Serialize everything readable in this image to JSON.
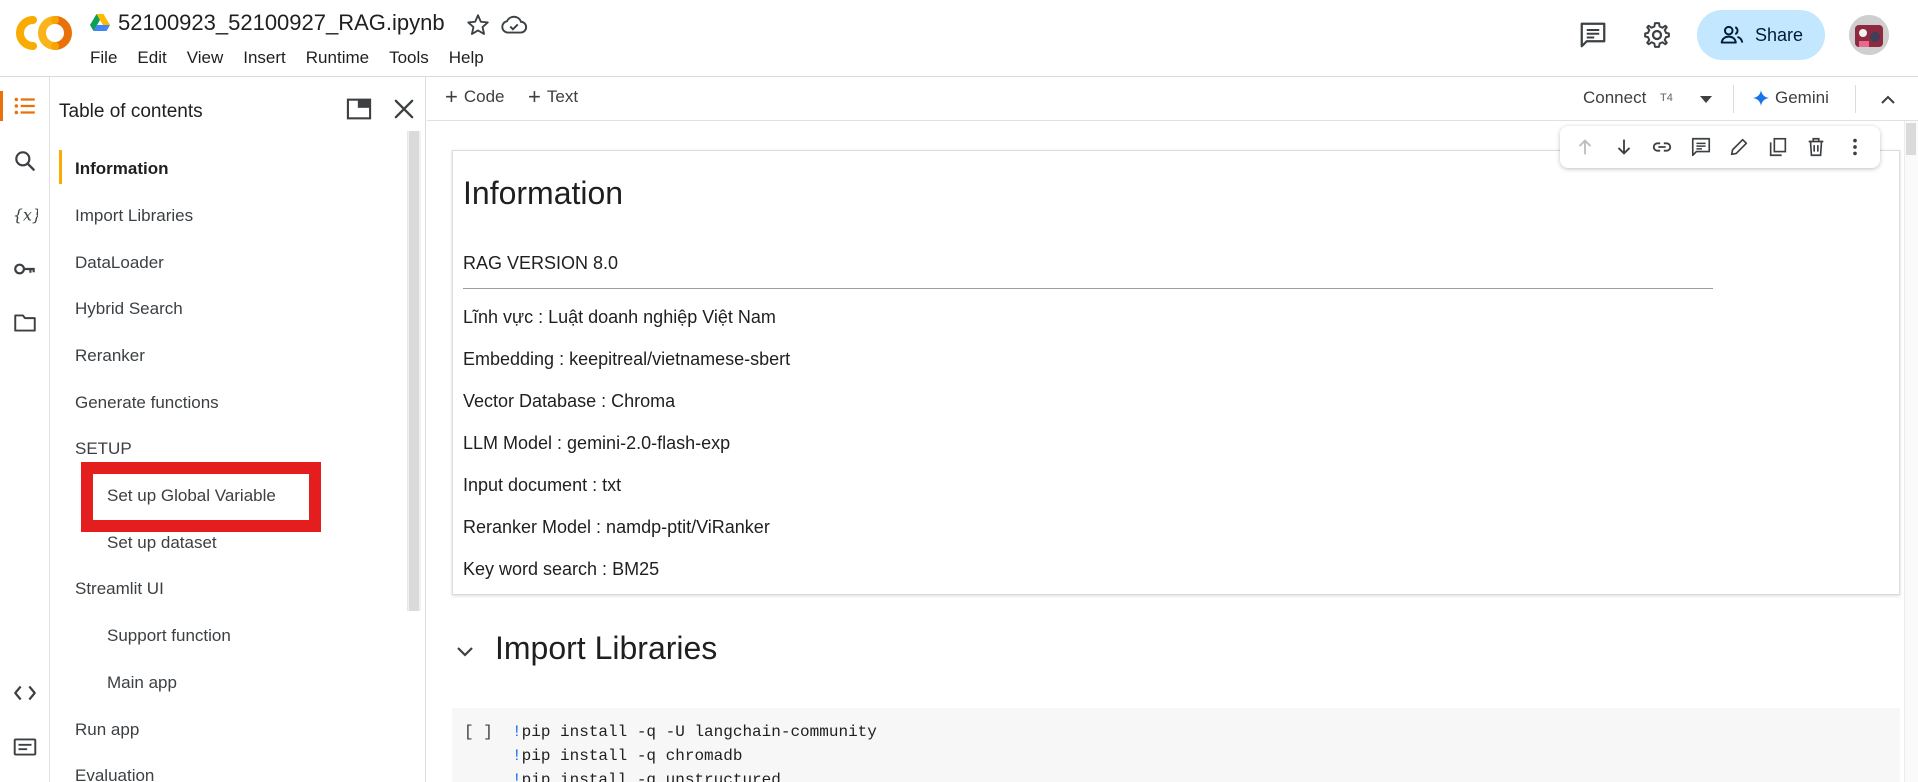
{
  "header": {
    "app_logo_text": "CO",
    "filename": "52100923_52100927_RAG.ipynb",
    "menu": [
      "File",
      "Edit",
      "View",
      "Insert",
      "Runtime",
      "Tools",
      "Help"
    ],
    "share_label": "Share"
  },
  "rail": {
    "items": [
      "table-of-contents",
      "search",
      "variables",
      "secrets",
      "files",
      "code-snippets",
      "terminal"
    ],
    "active": "table-of-contents"
  },
  "toc": {
    "title": "Table of contents",
    "items": [
      {
        "label": "Information",
        "level": 1,
        "active": true
      },
      {
        "label": "Import Libraries",
        "level": 1
      },
      {
        "label": "DataLoader",
        "level": 1
      },
      {
        "label": "Hybrid Search",
        "level": 1
      },
      {
        "label": "Reranker",
        "level": 1
      },
      {
        "label": "Generate functions",
        "level": 1
      },
      {
        "label": "SETUP",
        "level": 1
      },
      {
        "label": "Set up Global Variable",
        "level": 2,
        "highlighted": true
      },
      {
        "label": "Set up dataset",
        "level": 2
      },
      {
        "label": "Streamlit UI",
        "level": 1
      },
      {
        "label": "Support function",
        "level": 2
      },
      {
        "label": "Main app",
        "level": 2
      },
      {
        "label": "Run app",
        "level": 1
      },
      {
        "label": "Evaluation",
        "level": 1
      }
    ]
  },
  "notebook_toolbar": {
    "add_code_label": "Code",
    "add_text_label": "Text",
    "connect_label": "Connect",
    "runtime_type": "T4",
    "gemini_label": "Gemini"
  },
  "cell_toolbar": {
    "actions": [
      "move-up",
      "move-down",
      "link",
      "comment",
      "edit",
      "mirror-cell",
      "delete",
      "more"
    ]
  },
  "info_cell": {
    "heading": "Information",
    "version": "RAG VERSION 8.0",
    "lines": [
      "Lĩnh vực : Luật doanh nghiệp Việt Nam",
      "Embedding : keepitreal/vietnamese-sbert",
      "Vector Database : Chroma",
      "LLM Model : gemini-2.0-flash-exp",
      "Input document : txt",
      "Reranker Model : namdp-ptit/ViRanker",
      "Key word search : BM25"
    ]
  },
  "section": {
    "heading": "Import Libraries"
  },
  "code_cell": {
    "run_indicator": "[ ]",
    "lines": [
      "pip install -q -U langchain-community",
      "pip install -q chromadb",
      "pip install -q unstructured"
    ]
  },
  "colors": {
    "accent_orange": "#e8710a",
    "toc_active_bar": "#f9ab00",
    "share_bg": "#c2e7ff",
    "highlight_red": "#e41e1e",
    "gemini_blue": "#1a73e8"
  }
}
